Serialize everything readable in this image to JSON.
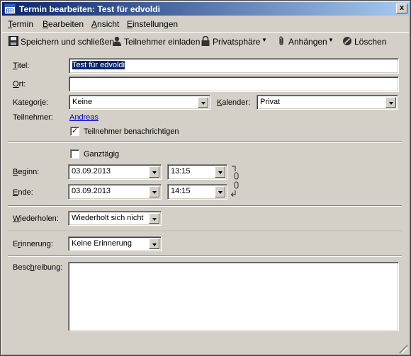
{
  "window": {
    "title": "Termin bearbeiten: Test für edvoldi",
    "close_label": "x"
  },
  "menu": {
    "items": [
      {
        "first": "T",
        "rest": "ermin"
      },
      {
        "first": "B",
        "rest": "earbeiten"
      },
      {
        "first": "A",
        "rest": "nsicht"
      },
      {
        "first": "E",
        "rest": "instellungen"
      }
    ]
  },
  "toolbar": {
    "save_close": "Speichern und schließen",
    "invite": "Teilnehmer einladen",
    "privacy": "Privatsphäre",
    "attach": "Anhängen",
    "delete": "Löschen"
  },
  "form": {
    "title_label_u": "T",
    "title_label_rest": "itel:",
    "title_value": "Test für edvoldi",
    "location_label_u": "O",
    "location_label_rest": "rt:",
    "location_value": "",
    "category_label_pre": "Kategor",
    "category_label_u": "i",
    "category_label_rest": "e:",
    "category_value": "Keine",
    "calendar_label_u": "K",
    "calendar_label_rest": "alender:",
    "calendar_value": "Privat",
    "attendees_label": "Teilnehmer:",
    "attendees_value": "Andreas",
    "notify_label": "Teilnehmer benachrichtigen",
    "notify_checked": true,
    "allday_label": "Ganztägig",
    "allday_checked": false,
    "start_label_u": "B",
    "start_label_rest": "eginn:",
    "start_date": "03.09.2013",
    "start_time": "13:15",
    "end_label_u": "E",
    "end_label_rest": "nde:",
    "end_date": "03.09.2013",
    "end_time": "14:15",
    "repeat_label_u": "W",
    "repeat_label_rest": "iederholen:",
    "repeat_value": "Wiederholt sich nicht",
    "reminder_label_pre": "E",
    "reminder_label_u": "r",
    "reminder_label_rest": "innerung:",
    "reminder_value": "Keine Erinnerung",
    "description_label_pre": "Besc",
    "description_label_u": "h",
    "description_label_rest": "reibung:",
    "description_value": ""
  }
}
